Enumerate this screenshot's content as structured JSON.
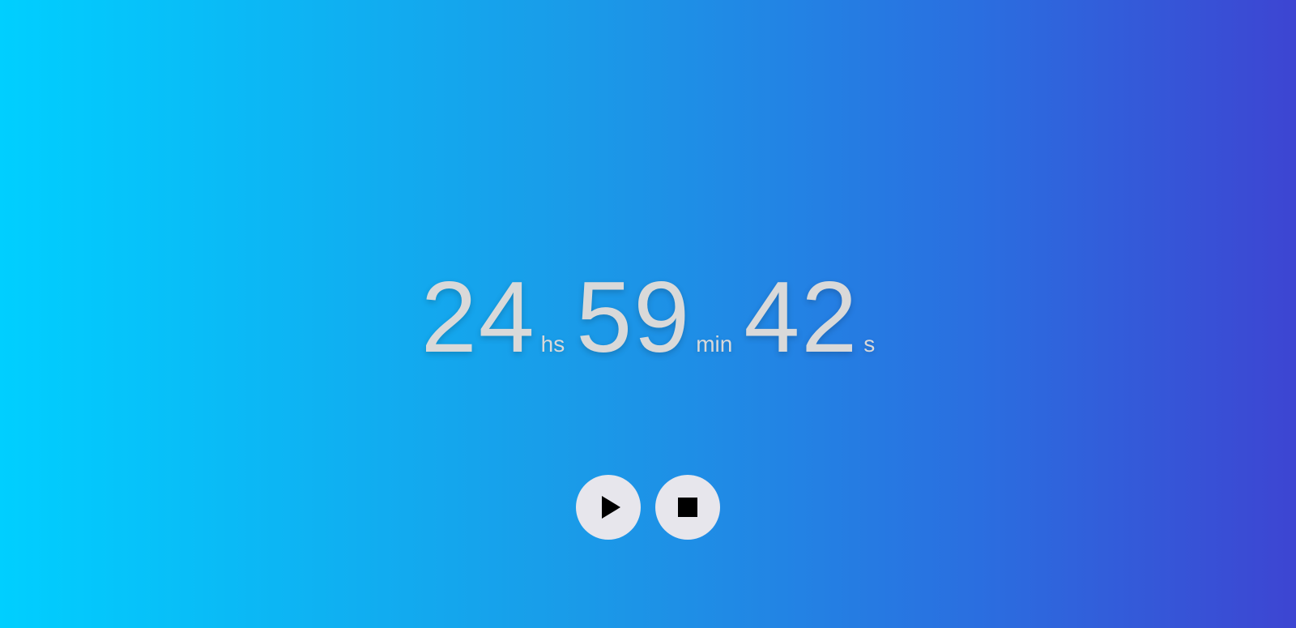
{
  "timer": {
    "hours": "24",
    "hours_unit": "hs",
    "minutes": "59",
    "minutes_unit": "min",
    "seconds": "42",
    "seconds_unit": "s"
  },
  "controls": {
    "play_icon": "play-icon",
    "stop_icon": "stop-icon"
  },
  "colors": {
    "gradient_start": "#00cfff",
    "gradient_end": "#3d45d2",
    "digits": "#d9d9d9",
    "button_bg": "#e7e6ec"
  }
}
